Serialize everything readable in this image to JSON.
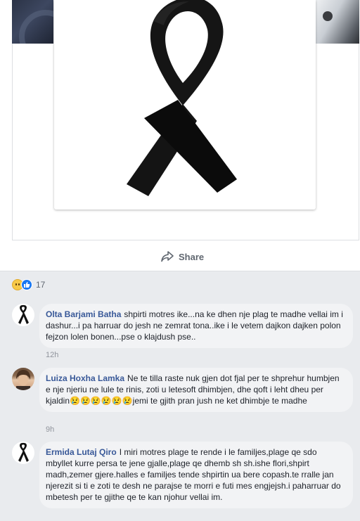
{
  "post": {
    "share_label": "Share"
  },
  "reactions": {
    "count": "17",
    "types": [
      "sad-emoji",
      "like-icon"
    ]
  },
  "comments": [
    {
      "author": "Olta Barjami Batha",
      "text": "shpirti motres ike...na ke dhen nje plag te madhe vellai im i dashur...i pa harruar do jesh ne zemrat tona..ike i le vetem dajkon dajken polon fejzon lolen bonen...pse o klajdush pse..",
      "time": "12h",
      "avatar": "black-ribbon-avatar"
    },
    {
      "author": "Luiza Hoxha Lamka",
      "text": "Ne te tilla raste nuk gjen dot fjal per te shprehur humbjen e nje njeriu ne lule te rinis, zoti u letesoft dhimbjen, dhe qoft i leht dheu per kjaldin😢😢😢😢😢😢jemi te gjith pran jush ne ket dhimbje te madhe",
      "time": "9h",
      "avatar": "user-photo-avatar"
    },
    {
      "author": "Ermida Lutaj Qiro",
      "text": "I miri motres plage te rende i le familjes,plage qe sdo mbyllet kurre persa te jene gjalle,plage qe dhemb sh sh.ishe flori,shpirt madh,zemer gjere.halles e familjes tende shpirtin ua bere copash.te rralle jan njerezit si ti e zoti te desh ne parajse te morri e futi mes engjejsh.i paharruar do mbetesh per te gjithe qe te kan njohur vellai im.",
      "time": "",
      "avatar": "black-ribbon-avatar"
    }
  ],
  "colors": {
    "background": "#e9ebee",
    "bubble": "#f2f3f5",
    "author_link": "#385898",
    "meta_text": "#90949c",
    "ribbon": "#111111"
  }
}
